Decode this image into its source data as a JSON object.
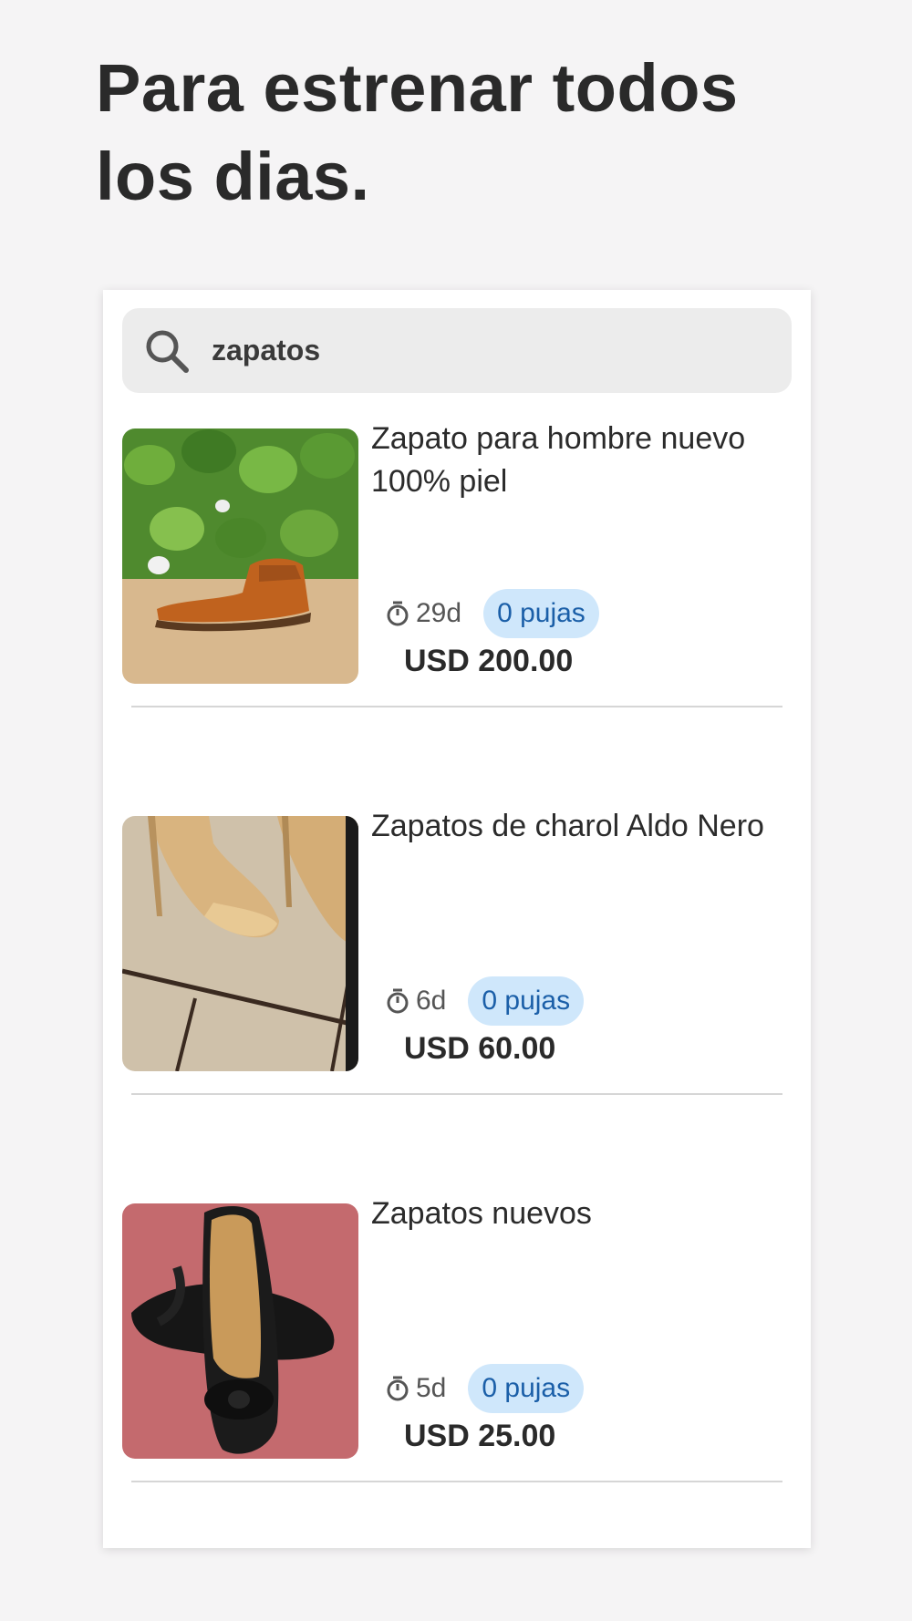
{
  "headline": "Para estrenar todos los dias.",
  "search": {
    "query": "zapatos",
    "icon": "search-icon"
  },
  "listings": [
    {
      "title": "Zapato para hombre nuevo 100% piel",
      "time_left": "29d",
      "bids": "0 pujas",
      "price": "USD 200.00"
    },
    {
      "title": "Zapatos de charol Aldo Nero",
      "time_left": "6d",
      "bids": "0 pujas",
      "price": "USD 60.00"
    },
    {
      "title": "Zapatos nuevos",
      "time_left": "5d",
      "bids": "0 pujas",
      "price": "USD 25.00"
    }
  ],
  "colors": {
    "background": "#f5f4f5",
    "card": "#ffffff",
    "search_bg": "#ececec",
    "badge_bg": "#cfe7fb",
    "badge_text": "#1b5fa8",
    "text": "#2b2b2b"
  }
}
